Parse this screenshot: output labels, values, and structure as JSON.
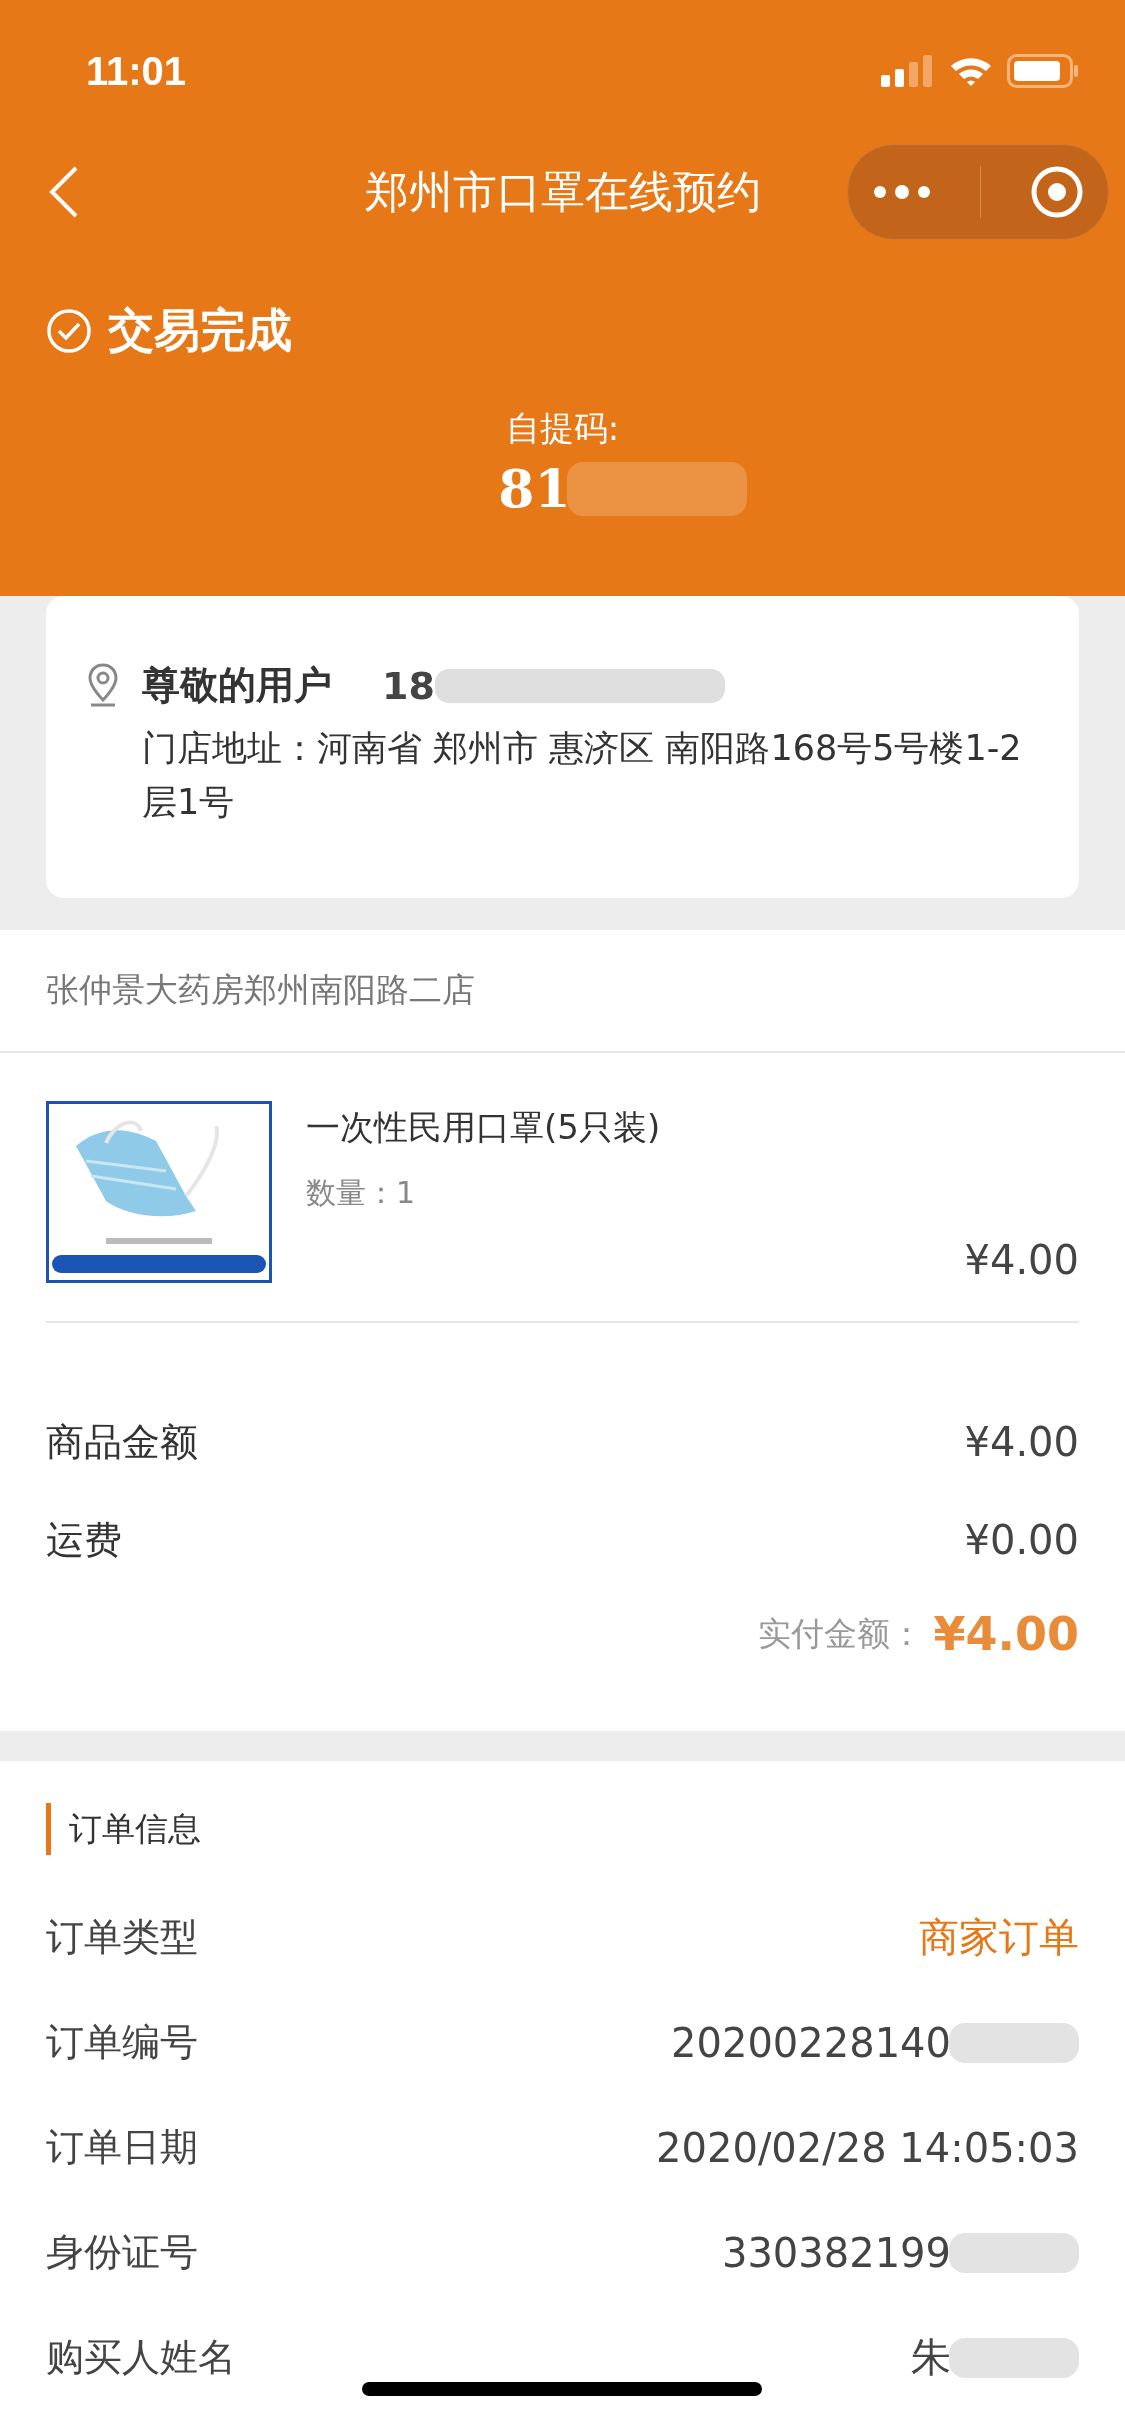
{
  "status_bar": {
    "time": "11:01"
  },
  "nav": {
    "title": "郑州市口罩在线预约"
  },
  "order_status": {
    "label": "交易完成",
    "pickup_label": "自提码:",
    "pickup_code": "81"
  },
  "address_card": {
    "name": "尊敬的用户",
    "phone": "18",
    "address": "门店地址：河南省 郑州市 惠济区 南阳路168号5号楼1-2层1号"
  },
  "store": {
    "name": "张仲景大药房郑州南阳路二店"
  },
  "product": {
    "kind": "picture",
    "title": "一次性民用口罩(5只装)",
    "quantity": "数量：1",
    "price": "¥4.00"
  },
  "summary": [
    {
      "label": "商品金额",
      "value": "¥4.00"
    },
    {
      "label": "运费",
      "value": "¥0.00"
    }
  ],
  "total": {
    "label": "实付金额：",
    "value": "¥4.00"
  },
  "order_info": {
    "title": "订单信息",
    "rows": [
      {
        "label": "订单类型",
        "value": "商家订单",
        "highlight": true,
        "blurred": false
      },
      {
        "label": "订单编号",
        "value": "20200228140",
        "highlight": false,
        "blurred": true
      },
      {
        "label": "订单日期",
        "value": "2020/02/28 14:05:03",
        "highlight": false,
        "blurred": false
      },
      {
        "label": "身份证号",
        "value": "330382199",
        "highlight": false,
        "blurred": true
      },
      {
        "label": "购买人姓名",
        "value": "朱",
        "highlight": false,
        "blurred": true
      }
    ]
  }
}
